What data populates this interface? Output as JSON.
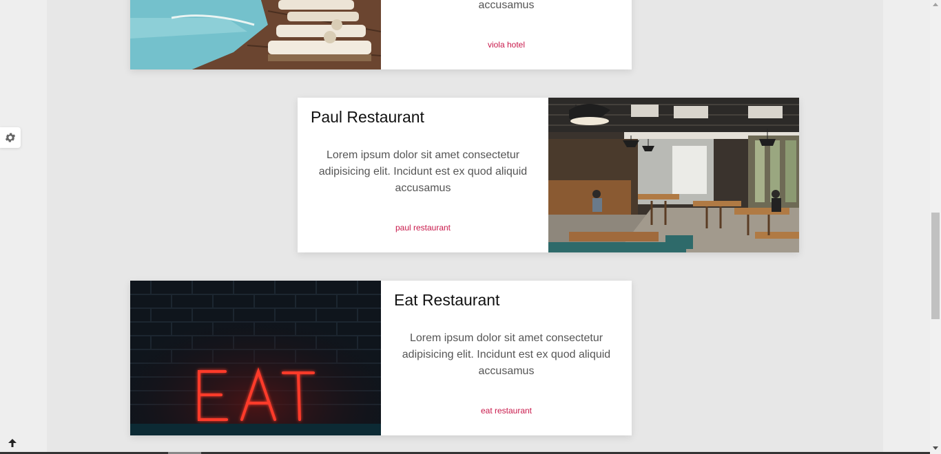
{
  "cards": [
    {
      "title": "",
      "description": "accusamus",
      "link": "viola hotel",
      "image": "hotel-pool-photo"
    },
    {
      "title": "Paul Restaurant",
      "description": "Lorem ipsum dolor sit amet consectetur adipisicing elit. Incidunt est ex quod aliquid accusamus",
      "link": "paul restaurant",
      "image": "restaurant-interior-photo"
    },
    {
      "title": "Eat Restaurant",
      "description": "Lorem ipsum dolor sit amet consectetur adipisicing elit. Incidunt est ex quod aliquid accusamus",
      "link": "eat restaurant",
      "image": "eat-neon-sign-photo"
    }
  ],
  "controls": {
    "settings_icon": "gear-icon",
    "scroll_top_icon": "arrow-up-icon"
  },
  "colors": {
    "link": "#c8184a",
    "page_bg": "#e7e7e7",
    "card_bg": "#ffffff"
  }
}
